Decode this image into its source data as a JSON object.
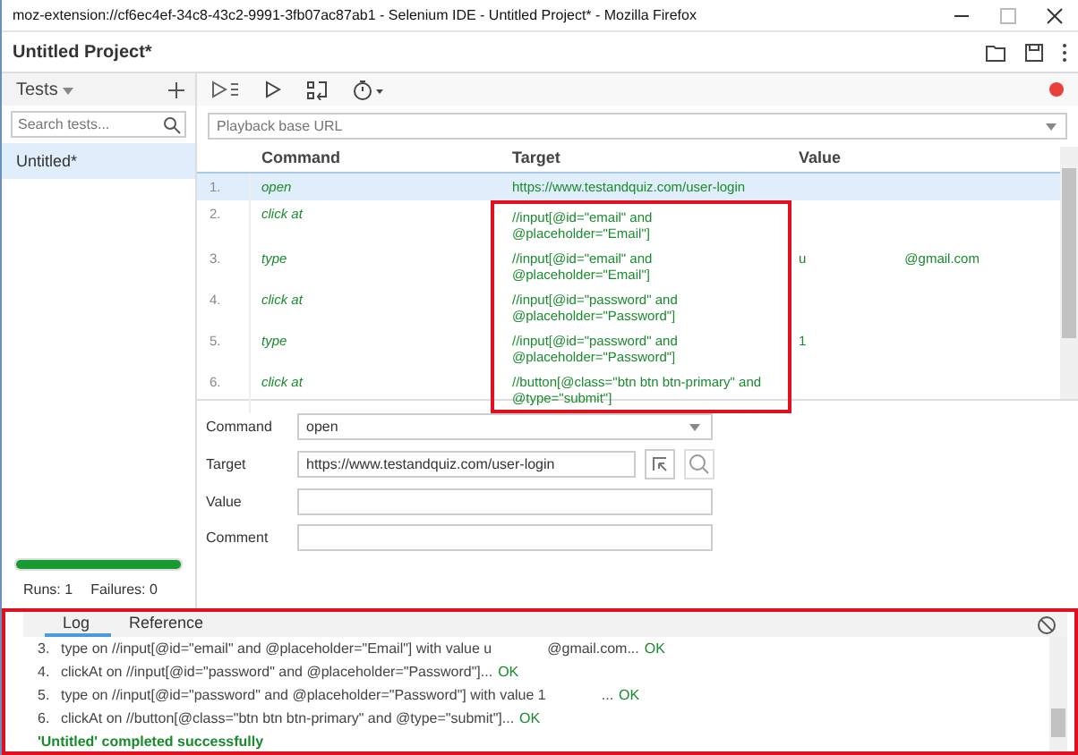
{
  "window": {
    "title": "moz-extension://cf6ec4ef-34c8-43c2-9991-3fb07ac87ab1 - Selenium IDE - Untitled Project* - Mozilla Firefox"
  },
  "project": {
    "title": "Untitled Project*"
  },
  "sidebar": {
    "heading": "Tests",
    "search": {
      "placeholder": "Search tests..."
    },
    "items": [
      {
        "label": "Untitled*",
        "selected": true
      }
    ],
    "progress": {
      "level": 1.0
    },
    "runs": "Runs: 1",
    "failures": "Failures: 0"
  },
  "toolbar": {
    "recording": true
  },
  "base_url": {
    "placeholder": "Playback base URL"
  },
  "table": {
    "columns": [
      "Command",
      "Target",
      "Value"
    ],
    "rows": [
      {
        "number": "1.",
        "command": "open",
        "target": "https://www.testandquiz.com/user-login",
        "selected": true,
        "highlighted": false
      },
      {
        "number": "2.",
        "command": "click at",
        "target": "//input[@id=\"email\" and @placeholder=\"Email\"]",
        "selected": false,
        "highlighted": true
      },
      {
        "number": "3.",
        "command": "type",
        "target": "//input[@id=\"email\" and @placeholder=\"Email\"]",
        "value": "u",
        "value_2": "@gmail.com",
        "selected": false,
        "highlighted": true
      },
      {
        "number": "4.",
        "command": "click at",
        "target": "//input[@id=\"password\" and @placeholder=\"Password\"]",
        "selected": false,
        "highlighted": true
      },
      {
        "number": "5.",
        "command": "type",
        "target": "//input[@id=\"password\" and @placeholder=\"Password\"]",
        "value": "1",
        "selected": false,
        "highlighted": true
      },
      {
        "number": "6.",
        "command": "click at",
        "target": "//button[@class=\"btn btn btn-primary\" and @type=\"submit\"]",
        "selected": false,
        "highlighted": true
      }
    ]
  },
  "editor": {
    "fields": [
      {
        "label": "Command",
        "kind": "select",
        "value": "open"
      },
      {
        "label": "Target",
        "kind": "target",
        "value": "https://www.testandquiz.com/user-login"
      },
      {
        "label": "Value",
        "kind": "text"
      },
      {
        "label": "Comment",
        "kind": "text"
      }
    ]
  },
  "log_panel": {
    "highlighted": true,
    "tabs": [
      {
        "label": "Log",
        "selected": true
      },
      {
        "label": "Reference",
        "selected": false
      }
    ],
    "entries": [
      {
        "number": "3.",
        "text": "type on //input[@id=\"email\" and @placeholder=\"Email\"] with value u",
        "tail": "@gmail.com...",
        "status": "OK"
      },
      {
        "number": "4.",
        "text": "clickAt on //input[@id=\"password\" and @placeholder=\"Password\"]...",
        "status": "OK"
      },
      {
        "number": "5.",
        "text": "type on //input[@id=\"password\" and @placeholder=\"Password\"] with value 1",
        "tail": "...",
        "status": "OK"
      },
      {
        "number": "6.",
        "text": "clickAt on //button[@class=\"btn btn btn-primary\" and @type=\"submit\"]...",
        "status": "OK"
      }
    ],
    "summary": "'Untitled' completed successfully"
  }
}
